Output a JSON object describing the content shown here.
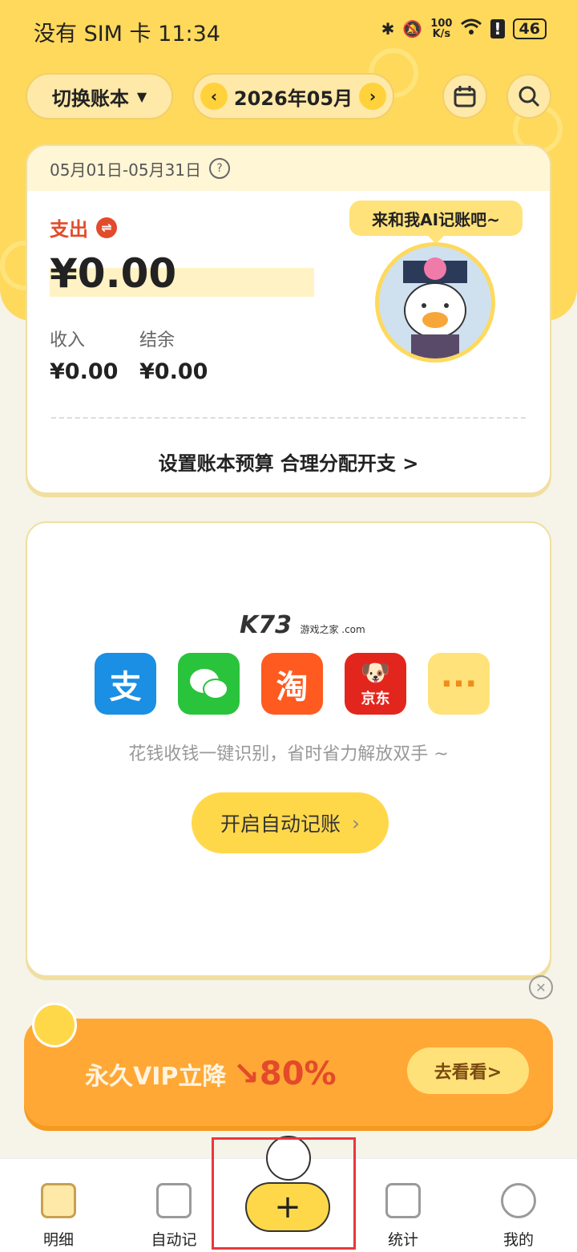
{
  "status_bar": {
    "carrier_time": "没有 SIM 卡 11:34",
    "speed_top": "100",
    "speed_bottom": "K/s",
    "battery": "46"
  },
  "header": {
    "book_switch": "切换账本",
    "month": "2026年05月"
  },
  "summary": {
    "date_range": "05月01日-05月31日",
    "expense_label": "支出",
    "expense_value": "¥0.00",
    "income_label": "收入",
    "income_value": "¥0.00",
    "balance_label": "结余",
    "balance_value": "¥0.00",
    "budget_link": "设置账本预算 合理分配开支 >",
    "ai_bubble": "来和我AI记账吧~"
  },
  "auto_record": {
    "watermark": "K73",
    "watermark_sub": "游戏之家 .com",
    "apps": [
      "支",
      "微信",
      "淘",
      "京东",
      "···"
    ],
    "hint": "花钱收钱一键识别，省时省力解放双手 ~",
    "button": "开启自动记账"
  },
  "promo": {
    "text": "永久VIP立降",
    "percent": "↘80%",
    "go": "去看看>"
  },
  "tabbar": {
    "detail": "明细",
    "auto": "自动记",
    "add": "+",
    "stats": "统计",
    "mine": "我的"
  },
  "colors": {
    "primary_yellow": "#ffd95c",
    "expense_red": "#e24b2b",
    "promo_orange": "#ffa836"
  }
}
